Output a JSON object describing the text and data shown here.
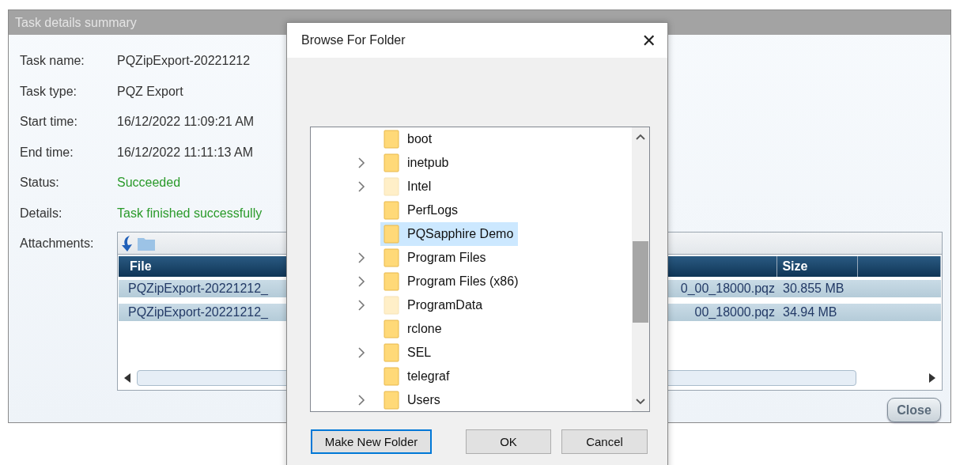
{
  "window": {
    "title": "Task details summary"
  },
  "details": [
    {
      "label": "Task name:",
      "value": "PQZipExport-20221212",
      "kind": "plain"
    },
    {
      "label": "Task type:",
      "value": "PQZ Export",
      "kind": "plain"
    },
    {
      "label": "Start time:",
      "value": "16/12/2022 11:09:21 AM",
      "kind": "plain"
    },
    {
      "label": "End time:",
      "value": "16/12/2022 11:11:13 AM",
      "kind": "plain"
    },
    {
      "label": "Status:",
      "value": "Succeeded",
      "kind": "success"
    },
    {
      "label": "Details:",
      "value": "Task finished successfully",
      "kind": "success"
    }
  ],
  "attachments": {
    "label": "Attachments:",
    "columns": [
      "File",
      "Size"
    ],
    "rows": [
      {
        "file_start": "PQZipExport-20221212_",
        "file_end": "0_00_18000.pqz",
        "size": "30.855 MB",
        "selected": true
      },
      {
        "file_start": "PQZipExport-20221212_",
        "file_end": "00_18000.pqz",
        "size": "34.94 MB",
        "selected": true
      }
    ]
  },
  "close_button": "Close",
  "dialog": {
    "title": "Browse For Folder",
    "close": "✕",
    "tree": [
      {
        "name": "boot",
        "expandable": false,
        "hidden": false,
        "selected": false
      },
      {
        "name": "inetpub",
        "expandable": true,
        "hidden": false,
        "selected": false
      },
      {
        "name": "Intel",
        "expandable": true,
        "hidden": true,
        "selected": false
      },
      {
        "name": "PerfLogs",
        "expandable": false,
        "hidden": false,
        "selected": false
      },
      {
        "name": "PQSapphire Demo",
        "expandable": false,
        "hidden": false,
        "selected": true
      },
      {
        "name": "Program Files",
        "expandable": true,
        "hidden": false,
        "selected": false
      },
      {
        "name": "Program Files (x86)",
        "expandable": true,
        "hidden": false,
        "selected": false
      },
      {
        "name": "ProgramData",
        "expandable": true,
        "hidden": true,
        "selected": false
      },
      {
        "name": "rclone",
        "expandable": false,
        "hidden": false,
        "selected": false
      },
      {
        "name": "SEL",
        "expandable": true,
        "hidden": false,
        "selected": false
      },
      {
        "name": "telegraf",
        "expandable": false,
        "hidden": false,
        "selected": false
      },
      {
        "name": "Users",
        "expandable": true,
        "hidden": false,
        "selected": false
      }
    ],
    "buttons": [
      {
        "label": "Make New Folder",
        "focused": true
      },
      {
        "label": "OK",
        "focused": false
      },
      {
        "label": "Cancel",
        "focused": false
      }
    ]
  }
}
